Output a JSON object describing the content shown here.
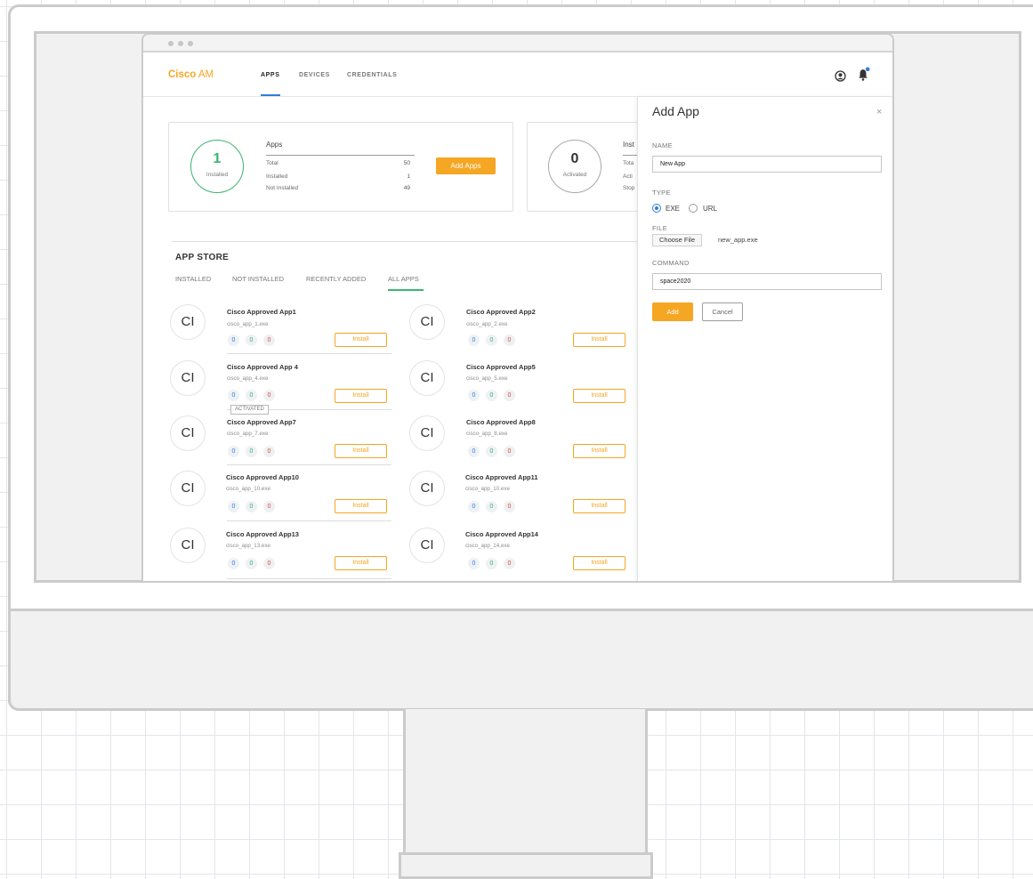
{
  "header": {
    "brand_bold": "Cisco",
    "brand_light": " AM",
    "tabs": [
      {
        "label": "APPS",
        "active": true
      },
      {
        "label": "DEVICES",
        "active": false
      },
      {
        "label": "CREDENTIALS",
        "active": false
      }
    ]
  },
  "apps_summary": {
    "count": "1",
    "count_label": "Installed",
    "title": "Apps",
    "rows": [
      {
        "label": "Total",
        "value": "50"
      },
      {
        "label": "Installed",
        "value": "1"
      },
      {
        "label": "Not Installed",
        "value": "49"
      }
    ],
    "button_label": "Add Apps"
  },
  "instances_summary": {
    "count": "0",
    "count_label": "Activated",
    "title": "Inst",
    "rows": [
      {
        "label": "Tota"
      },
      {
        "label": "Acti"
      },
      {
        "label": "Stop"
      }
    ]
  },
  "app_store": {
    "title": "APP STORE",
    "tabs": [
      {
        "label": "INSTALLED",
        "active": false
      },
      {
        "label": "NOT INSTALLED",
        "active": false
      },
      {
        "label": "RECENTLY ADDED",
        "active": false
      },
      {
        "label": "ALL APPS",
        "active": true
      }
    ],
    "install_label": "Install",
    "activated_label": "ACTIVATED",
    "apps": [
      {
        "avatar": "CI",
        "name": "Cisco Approved App1",
        "file": "cisco_app_1.exe",
        "counts": [
          "0",
          "0",
          "0"
        ]
      },
      {
        "avatar": "CI",
        "name": "Cisco Approved App2",
        "file": "cisco_app_2.exe",
        "counts": [
          "0",
          "0",
          "0"
        ]
      },
      {
        "avatar": "CI",
        "name": "Cisco Approved App 4",
        "file": "cisco_app_4.exe",
        "counts": [
          "0",
          "0",
          "0"
        ]
      },
      {
        "avatar": "CI",
        "name": "Cisco Approved App5",
        "file": "cisco_app_5.exe",
        "counts": [
          "0",
          "0",
          "0"
        ]
      },
      {
        "avatar": "CI",
        "name": "Cisco Approved App7",
        "file": "cisco_app_7.exe",
        "counts": [
          "0",
          "0",
          "0"
        ]
      },
      {
        "avatar": "CI",
        "name": "Cisco Approved App8",
        "file": "cisco_app_8.exe",
        "counts": [
          "0",
          "0",
          "0"
        ]
      },
      {
        "avatar": "CI",
        "name": "Cisco Approved App10",
        "file": "cisco_app_10.exe",
        "counts": [
          "0",
          "0",
          "0"
        ]
      },
      {
        "avatar": "CI",
        "name": "Cisco Approved App11",
        "file": "cisco_app_10.exe",
        "counts": [
          "0",
          "0",
          "0"
        ]
      },
      {
        "avatar": "CI",
        "name": "Cisco Approved App13",
        "file": "cisco_app_13.exe",
        "counts": [
          "0",
          "0",
          "0"
        ]
      },
      {
        "avatar": "CI",
        "name": "Cisco Approved App14",
        "file": "cisco_app_14.exe",
        "counts": [
          "0",
          "0",
          "0"
        ]
      }
    ]
  },
  "add_app_panel": {
    "title": "Add App",
    "close_glyph": "×",
    "name_label": "NAME",
    "name_value": "New App",
    "type_label": "TYPE",
    "type_options": [
      {
        "label": "EXE",
        "selected": true
      },
      {
        "label": "URL",
        "selected": false
      }
    ],
    "file_label": "FILE",
    "choose_file_label": "Choose File",
    "file_name": "new_app.exe",
    "command_label": "COMMAND",
    "command_value": "space2020",
    "add_label": "Add",
    "cancel_label": "Cancel"
  },
  "icons": {
    "user": "user-circle-icon",
    "notifications": "bell-icon",
    "notification_badge_color": "#2f7fd6"
  },
  "colors": {
    "brand": "#f5a623",
    "accent_blue": "#2f7fd6",
    "success_green": "#3cb371",
    "danger_red": "#e04b3b"
  }
}
